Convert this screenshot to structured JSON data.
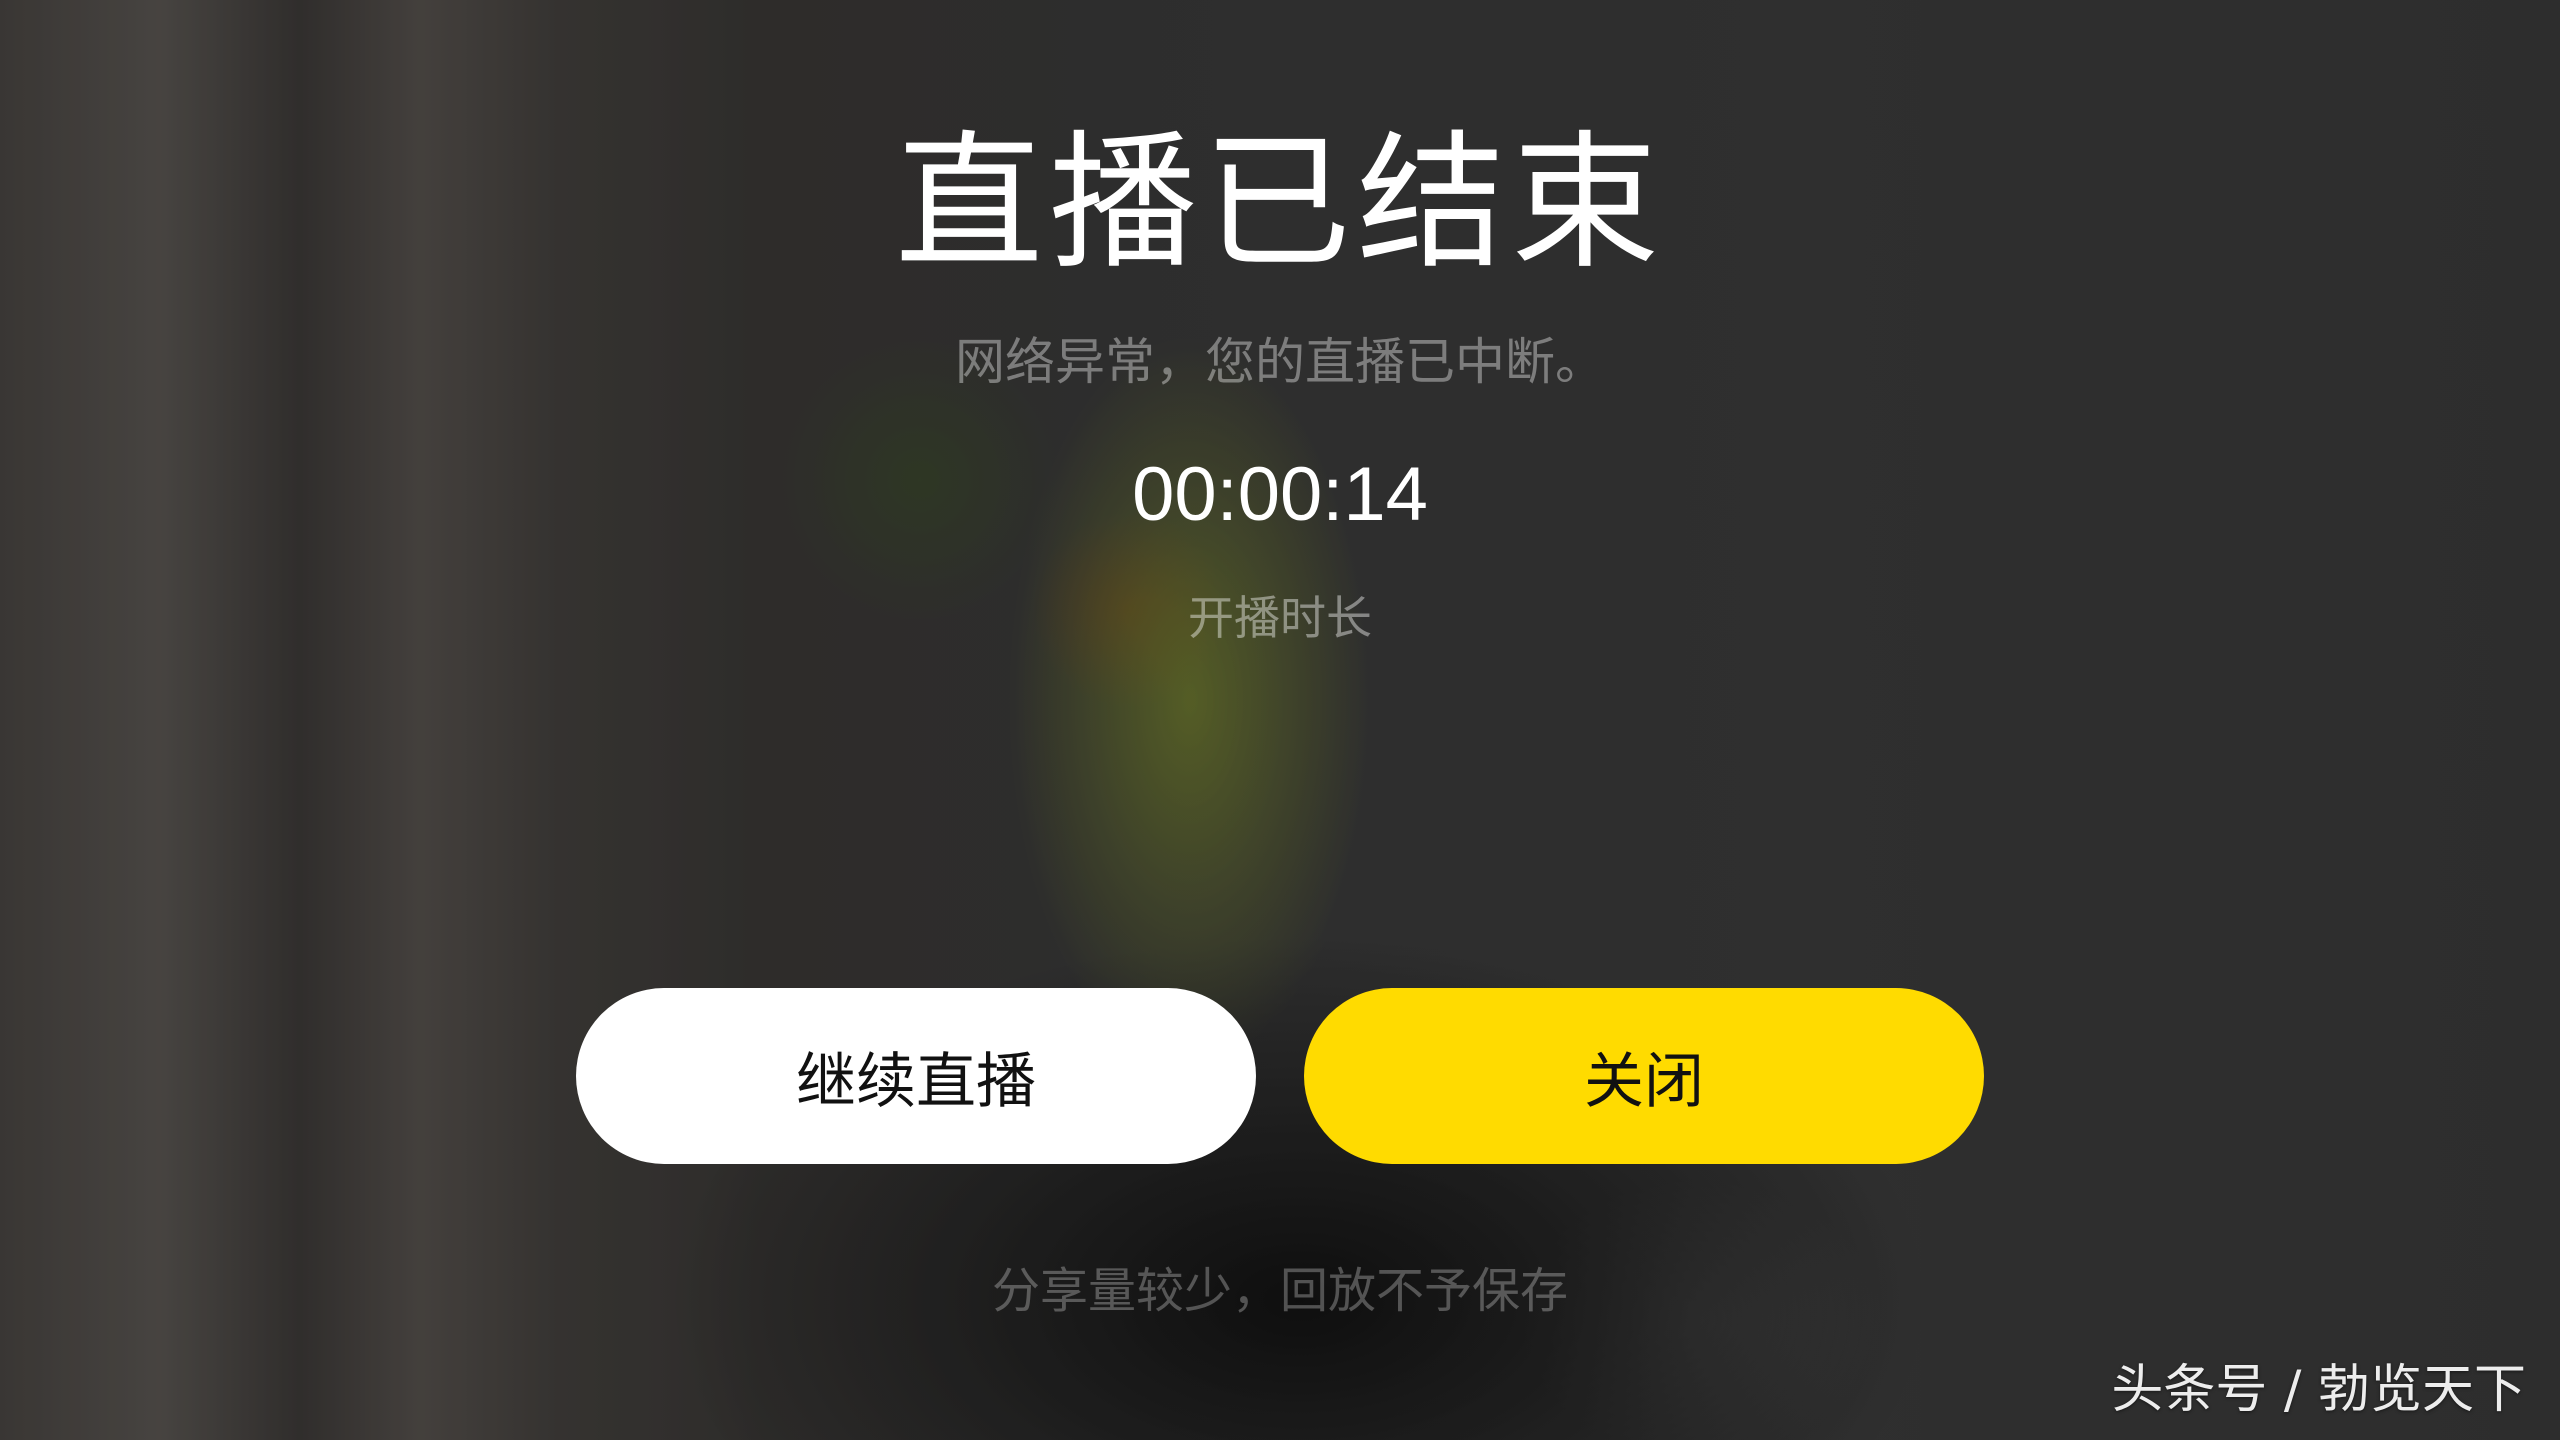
{
  "live_ended": {
    "title": "直播已结束",
    "message": "网络异常，您的直播已中断。",
    "duration_value": "00:00:14",
    "duration_label": "开播时长",
    "continue_button_label": "继续直播",
    "close_button_label": "关闭",
    "replay_note": "分享量较少，回放不予保存"
  },
  "watermark": {
    "text": "头条号 / 勃览天下"
  },
  "colors": {
    "close_button": "#ffdb00",
    "continue_button": "#ffffff",
    "title_text": "#ffffff"
  }
}
